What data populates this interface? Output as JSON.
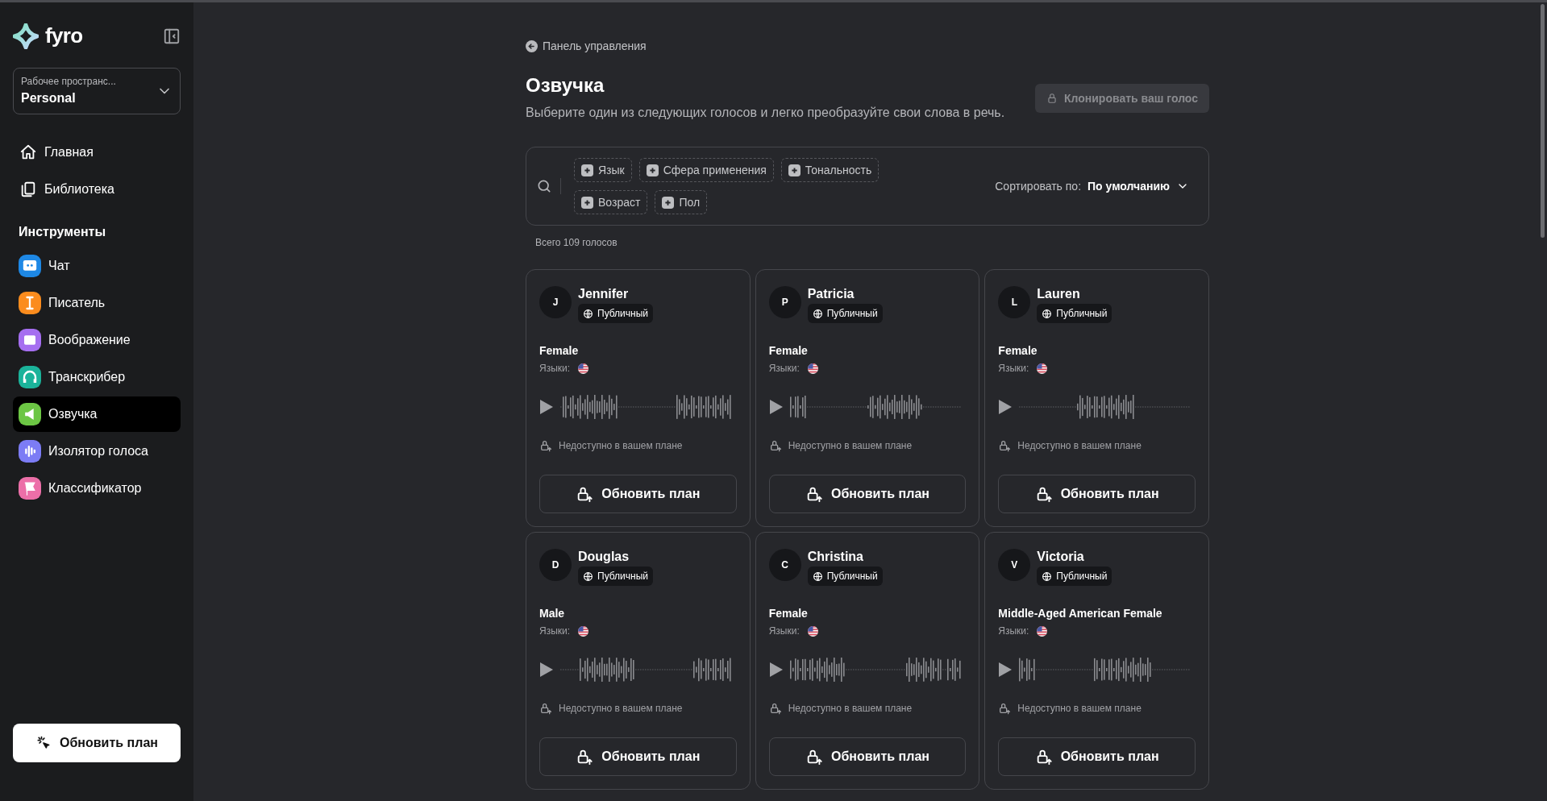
{
  "sidebar": {
    "logo": "fyro",
    "workspace": {
      "label": "Рабочее пространс...",
      "value": "Personal"
    },
    "nav": [
      {
        "label": "Главная",
        "kind": "home",
        "selected": false
      },
      {
        "label": "Библиотека",
        "kind": "library",
        "selected": false
      }
    ],
    "tools_heading": "Инструменты",
    "tools": [
      {
        "label": "Чат",
        "kind": "chat",
        "color": "#1e88e5",
        "selected": false
      },
      {
        "label": "Писатель",
        "kind": "writer",
        "color": "#fb8c1e",
        "selected": false
      },
      {
        "label": "Воображение",
        "kind": "image",
        "color": "#a56ef0",
        "selected": false
      },
      {
        "label": "Транскрибер",
        "kind": "headphones",
        "color": "#1bb39a",
        "selected": false
      },
      {
        "label": "Озвучка",
        "kind": "speaker",
        "color": "#6cc644",
        "selected": true
      },
      {
        "label": "Изолятор голоса",
        "kind": "wave",
        "color": "#7c7cf5",
        "selected": false
      },
      {
        "label": "Классификатор",
        "kind": "flag",
        "color": "#ec6fa8",
        "selected": false
      }
    ],
    "upgrade_button": "Обновить план"
  },
  "breadcrumb": "Панель управления",
  "title": "Озвучка",
  "subtitle": "Выберите один из следующих голосов и легко преобразуйте свои слова в речь.",
  "clone_button": {
    "label": "Клонировать ваш голос",
    "disabled": true
  },
  "filters": [
    "Язык",
    "Сфера применения",
    "Тональность",
    "Возраст",
    "Пол"
  ],
  "sort": {
    "label": "Сортировать по:",
    "value": "По умолчанию"
  },
  "total": "Всего 109 голосов",
  "voices": [
    {
      "initial": "J",
      "name": "Jennifer",
      "visibility": "Публичный",
      "description": "Female",
      "languages_label": "Языки:",
      "locked_note": "Недоступно в вашем плане",
      "button": "Обновить план"
    },
    {
      "initial": "P",
      "name": "Patricia",
      "visibility": "Публичный",
      "description": "Female",
      "languages_label": "Языки:",
      "locked_note": "Недоступно в вашем плане",
      "button": "Обновить план"
    },
    {
      "initial": "L",
      "name": "Lauren",
      "visibility": "Публичный",
      "description": "Female",
      "languages_label": "Языки:",
      "locked_note": "Недоступно в вашем плане",
      "button": "Обновить план"
    },
    {
      "initial": "D",
      "name": "Douglas",
      "visibility": "Публичный",
      "description": "Male",
      "languages_label": "Языки:",
      "locked_note": "Недоступно в вашем плане",
      "button": "Обновить план"
    },
    {
      "initial": "C",
      "name": "Christina",
      "visibility": "Публичный",
      "description": "Female",
      "languages_label": "Языки:",
      "locked_note": "Недоступно в вашем плане",
      "button": "Обновить план"
    },
    {
      "initial": "V",
      "name": "Victoria",
      "visibility": "Публичный",
      "description": "Middle-Aged American Female",
      "languages_label": "Языки:",
      "locked_note": "Недоступно в вашем плане",
      "button": "Обновить план"
    }
  ]
}
